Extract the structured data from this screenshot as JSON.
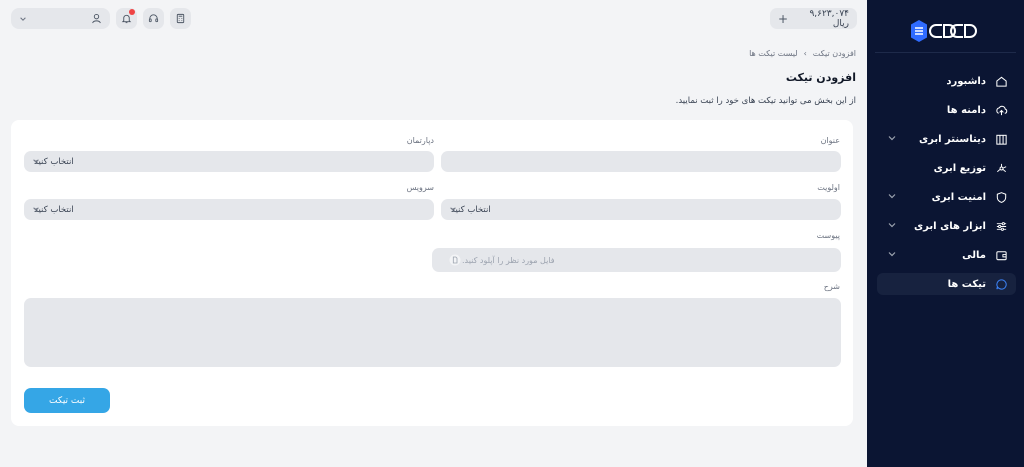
{
  "brand": {
    "logo_text": "CDCD",
    "accent": "#35a6e6"
  },
  "sidebar": {
    "items": [
      {
        "label": "داشبورد",
        "icon": "home-icon",
        "has_chevron": false
      },
      {
        "label": "دامنه ها",
        "icon": "cloud-upload-icon",
        "has_chevron": false
      },
      {
        "label": "دیتاسنتر ابری",
        "icon": "building-icon",
        "has_chevron": true
      },
      {
        "label": "توزیع ابری",
        "icon": "network-icon",
        "has_chevron": false
      },
      {
        "label": "امنیت ابری",
        "icon": "shield-icon",
        "has_chevron": true
      },
      {
        "label": "ابزار های ابری",
        "icon": "sliders-icon",
        "has_chevron": true
      },
      {
        "label": "مالی",
        "icon": "wallet-icon",
        "has_chevron": true
      },
      {
        "label": "تیکت ها",
        "icon": "chat-icon",
        "has_chevron": false,
        "active": true
      }
    ]
  },
  "topbar": {
    "balance": "۹,۶۲۳,۰۷۴ ریال",
    "balance_add": "+"
  },
  "breadcrumb": {
    "parent": "لیست تیکت ها",
    "separator": "›",
    "current": "افزودن تیکت"
  },
  "page": {
    "title": "افزودن تیکت",
    "description": "از این بخش می توانید تیکت های خود را ثبت نمایید."
  },
  "form": {
    "title_label": "عنوان",
    "title_value": "",
    "department_label": "دپارتمان",
    "department_value": "انتخاب کنید",
    "priority_label": "اولویت",
    "priority_value": "انتخاب کنید",
    "service_label": "سرویس",
    "service_value": "انتخاب کنید",
    "attachment_label": "پیوست",
    "attachment_placeholder": "فایل مورد نظر را آپلود کنید.",
    "description_label": "شرح",
    "submit_label": "ثبت تیکت"
  }
}
